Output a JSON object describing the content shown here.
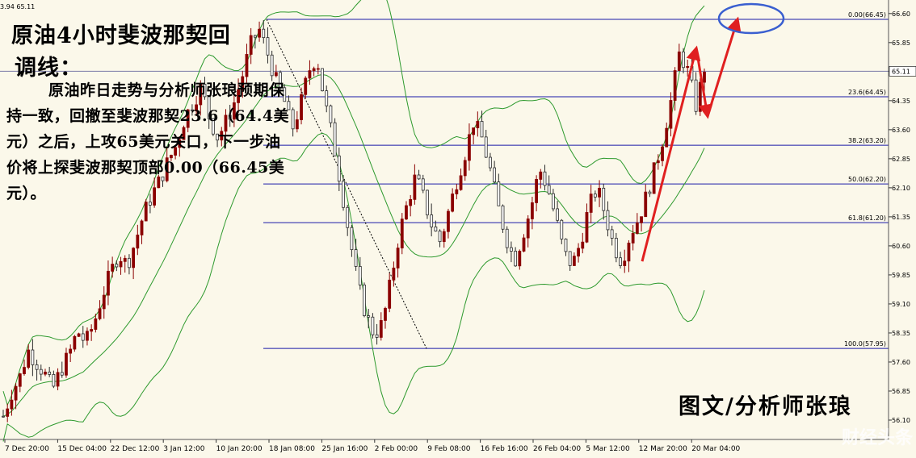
{
  "header_info": "3.94 65.11",
  "annotation": {
    "title_line1": "原油4小时斐波那契回",
    "title_line2": "调线：",
    "body": "原油昨日走势与分析师张琅预期保持一致，回撤至斐波那契23.6（64.4美元）之后，上攻65美元关口，下一步油价将上探斐波那契顶部0.00（66.45美元）。",
    "credit": "图文/分析师张琅",
    "watermark": "财经头条"
  },
  "colors": {
    "background": "#fbf8ea",
    "up_candle": "#8b0000",
    "down_candle": "#2a2a2a",
    "bollinger": "#2e9a2e",
    "fib_line": "#1a1aa8",
    "arrow": "#e02020",
    "ellipse": "#3a5fd0"
  },
  "chart_data": {
    "type": "candlestick",
    "instrument": "Crude oil, 4-hour",
    "title": "",
    "ylim": [
      55.6,
      66.95
    ],
    "y_ticks": [
      "66.60",
      "65.85",
      "65.11",
      "64.35",
      "63.60",
      "62.85",
      "62.10",
      "61.35",
      "60.60",
      "59.85",
      "59.10",
      "58.35",
      "57.60",
      "56.85",
      "56.10"
    ],
    "x_ticks": [
      "7 Dec 20:00",
      "15 Dec 04:00",
      "22 Dec 12:00",
      "3 Jan 12:00",
      "10 Jan 20:00",
      "18 Jan 08:00",
      "25 Jan 16:00",
      "2 Feb 00:00",
      "9 Feb 08:00",
      "16 Feb 16:00",
      "26 Feb 04:00",
      "5 Mar 12:00",
      "12 Mar 20:00",
      "20 Mar 04:00"
    ],
    "current_price": "65.11",
    "fib_levels": [
      {
        "label": "0.00(66.45)",
        "value": 66.45
      },
      {
        "label": "23.6(64.45)",
        "value": 64.45
      },
      {
        "label": "38.2(63.20)",
        "value": 63.2
      },
      {
        "label": "50.0(62.20)",
        "value": 62.2
      },
      {
        "label": "61.8(61.20)",
        "value": 61.2
      },
      {
        "label": "100.0(57.95)",
        "value": 57.95
      }
    ],
    "close_path": [
      56.2,
      56.8,
      57.2,
      57.9,
      57.6,
      57.3,
      56.9,
      57.4,
      57.8,
      58.4,
      58.1,
      58.6,
      59.3,
      59.9,
      60.4,
      60.1,
      60.7,
      61.4,
      61.9,
      62.3,
      62.8,
      63.2,
      63.9,
      64.3,
      64.7,
      63.9,
      63.4,
      63.8,
      64.3,
      65.0,
      65.8,
      66.2,
      65.6,
      64.9,
      64.4,
      63.6,
      64.2,
      65.1,
      65.5,
      64.3,
      63.3,
      62.1,
      60.8,
      59.6,
      58.8,
      58.3,
      58.6,
      59.7,
      60.9,
      61.7,
      62.4,
      61.8,
      61.1,
      60.7,
      61.5,
      62.3,
      63.0,
      63.8,
      63.4,
      62.6,
      61.6,
      60.8,
      60.2,
      60.9,
      61.6,
      62.6,
      62.1,
      61.3,
      60.4,
      60.1,
      60.7,
      61.6,
      62.1,
      61.4,
      60.6,
      60.2,
      60.9,
      61.3,
      61.9,
      62.6,
      63.4,
      64.4,
      65.6,
      65.1,
      64.2,
      65.2
    ]
  }
}
